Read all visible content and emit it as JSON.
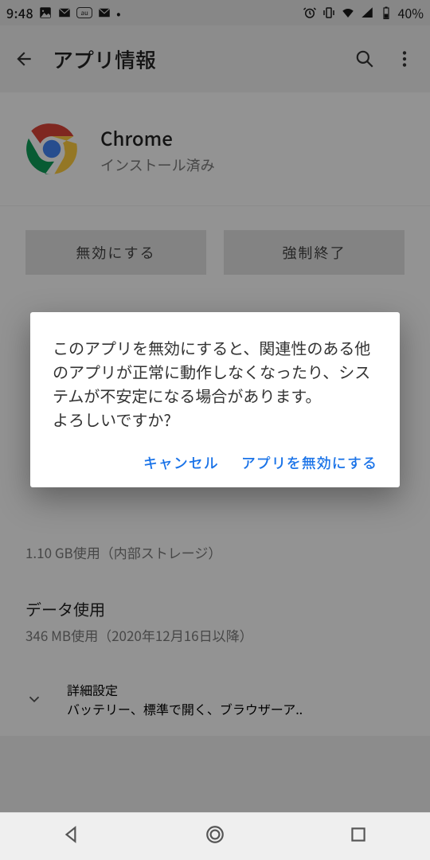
{
  "status": {
    "clock": "9:48",
    "battery_pct": "40%"
  },
  "appbar": {
    "title": "アプリ情報"
  },
  "app": {
    "name": "Chrome",
    "status": "インストール済み"
  },
  "buttons": {
    "disable": "無効にする",
    "force_stop": "強制終了"
  },
  "storage": {
    "sub": "1.10 GB使用（内部ストレージ）"
  },
  "data_usage": {
    "title": "データ使用",
    "sub": "346 MB使用（2020年12月16日以降）"
  },
  "advanced": {
    "title": "詳細設定",
    "sub": "バッテリー、標準で開く、ブラウザーア.."
  },
  "dialog": {
    "message": "このアプリを無効にすると、関連性のある他のアプリが正常に動作しなくなったり、システムが不安定になる場合があります。\nよろしいですか?",
    "cancel": "キャンセル",
    "confirm": "アプリを無効にする"
  }
}
